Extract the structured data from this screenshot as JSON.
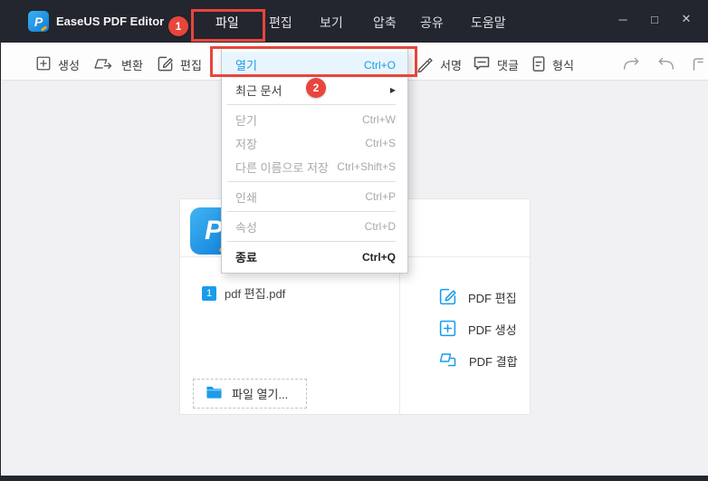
{
  "app": {
    "title": "EaseUS PDF Editor"
  },
  "titlebar": {
    "menus": [
      {
        "label": "파일"
      },
      {
        "label": "편집"
      },
      {
        "label": "보기"
      },
      {
        "label": "압축"
      },
      {
        "label": "공유"
      },
      {
        "label": "도움말"
      }
    ],
    "window_controls": {
      "minimize": "─",
      "maximize": "□",
      "close": "✕"
    }
  },
  "toolbar": {
    "items": [
      {
        "label": "생성",
        "icon": "plus-square-icon"
      },
      {
        "label": "변환",
        "icon": "convert-icon"
      },
      {
        "label": "편집",
        "icon": "edit-pencil-icon"
      },
      {
        "label": "서명",
        "icon": "signature-pen-icon"
      },
      {
        "label": "댓글",
        "icon": "comment-icon"
      },
      {
        "label": "형식",
        "icon": "format-doc-icon"
      }
    ],
    "history": {
      "redo": "redo-arrow-icon",
      "undo": "undo-arrow-icon",
      "clipped": "clipped-edge-icon"
    }
  },
  "file_menu": {
    "items": [
      {
        "label": "열기",
        "shortcut": "Ctrl+O",
        "state": "active"
      },
      {
        "label": "최근 문서",
        "shortcut": "",
        "has_submenu": true
      },
      {
        "label": "닫기",
        "shortcut": "Ctrl+W",
        "state": "disabled"
      },
      {
        "label": "저장",
        "shortcut": "Ctrl+S",
        "state": "disabled"
      },
      {
        "label": "다른 이름으로 저장",
        "shortcut": "Ctrl+Shift+S",
        "state": "disabled"
      },
      {
        "label": "인쇄",
        "shortcut": "Ctrl+P",
        "state": "disabled"
      },
      {
        "label": "속성",
        "shortcut": "Ctrl+D",
        "state": "disabled"
      },
      {
        "label": "종료",
        "shortcut": "Ctrl+Q",
        "state": "enabled"
      }
    ],
    "submenu_arrow": "▶"
  },
  "annotations": {
    "step1": "1",
    "step2": "2"
  },
  "main": {
    "logo_letter": "P",
    "recent_file": {
      "index": "1",
      "name": "pdf 편집.pdf"
    },
    "open_button_label": "파일 열기...",
    "quick_actions": [
      {
        "label": "PDF 편집",
        "icon": "edit-pencil-icon"
      },
      {
        "label": "PDF 생성",
        "icon": "plus-square-icon"
      },
      {
        "label": "PDF 결합",
        "icon": "merge-pages-icon"
      }
    ]
  },
  "colors": {
    "accent_blue": "#1a9cea",
    "annotation_red": "#e8453c",
    "titlebar_dark": "#23262e",
    "menu_highlight": "#e9f5fd"
  }
}
